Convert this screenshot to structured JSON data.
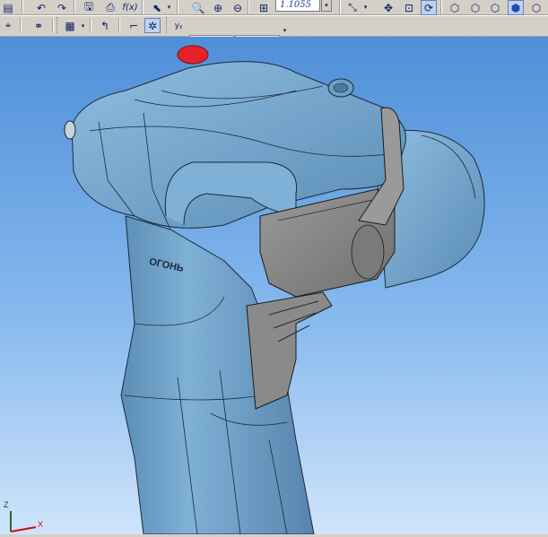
{
  "toolbar_top": {
    "zoom_value": "1.1055"
  },
  "toolbar_bottom": {
    "fields": [
      "",
      ""
    ]
  },
  "viewport": {
    "model_engraving": "ОГОНЬ",
    "background_top": "#4f8fd8",
    "background_bottom": "#cfe4fb",
    "model_color": "#6fa1c9",
    "section_color": "#8c8c8c",
    "accent_color": "#e8202a"
  },
  "triad": {
    "z_label": "Z",
    "x_label": "X"
  },
  "icons": [
    "list-icon",
    "undo-icon",
    "redo-icon",
    "save-icon",
    "print-icon",
    "fx-icon",
    "select-arrow-icon",
    "zoom-in-icon",
    "zoom-window-icon",
    "zoom-out-icon",
    "zoom-fit-icon",
    "pan-icon",
    "move-icon",
    "zoom-box-icon",
    "rotate-icon",
    "view-cube-icons",
    "snap-icon",
    "link-icon",
    "grid-icon",
    "axis-origin-icon",
    "corner-icon",
    "snap-star-icon",
    "coordinate-y-icon"
  ]
}
